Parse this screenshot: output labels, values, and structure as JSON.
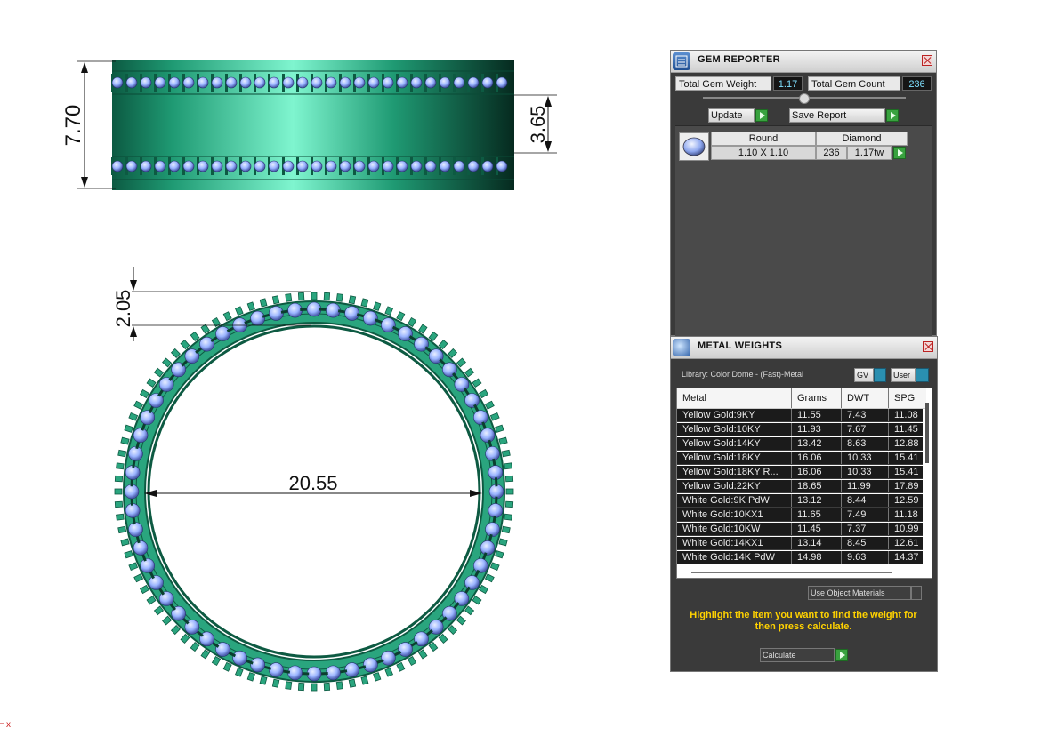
{
  "viewport": {
    "dimensions": {
      "side_height": "7.70",
      "channel_height": "3.65",
      "band_width": "2.05",
      "inner_diameter": "20.55"
    },
    "axis_marker": "x",
    "colors": {
      "metal": "#1f9a73",
      "metal_dark": "#0a4a36",
      "metal_light": "#7ff5cf",
      "gem": "#9ab4ff"
    }
  },
  "gem_reporter": {
    "title": "GEM REPORTER",
    "total_weight_label": "Total Gem Weight",
    "total_weight_value": "1.17",
    "total_count_label": "Total Gem Count",
    "total_count_value": "236",
    "update_label": "Update",
    "save_report_label": "Save Report",
    "gem": {
      "shape": "Round",
      "type": "Diamond",
      "size": "1.10 X 1.10",
      "count": "236",
      "weight": "1.17tw"
    }
  },
  "metal_weights": {
    "title": "METAL WEIGHTS",
    "library_label": "Library: Color Dome - (Fast)-Metal",
    "gv_label": "GV",
    "user_label": "User",
    "columns": [
      "Metal",
      "Grams",
      "DWT",
      "SPG"
    ],
    "rows": [
      {
        "metal": "Yellow Gold:9KY",
        "grams": "11.55",
        "dwt": "7.43",
        "spg": "11.08"
      },
      {
        "metal": "Yellow Gold:10KY",
        "grams": "11.93",
        "dwt": "7.67",
        "spg": "11.45"
      },
      {
        "metal": "Yellow Gold:14KY",
        "grams": "13.42",
        "dwt": "8.63",
        "spg": "12.88"
      },
      {
        "metal": "Yellow Gold:18KY",
        "grams": "16.06",
        "dwt": "10.33",
        "spg": "15.41"
      },
      {
        "metal": "Yellow Gold:18KY R...",
        "grams": "16.06",
        "dwt": "10.33",
        "spg": "15.41"
      },
      {
        "metal": "Yellow Gold:22KY",
        "grams": "18.65",
        "dwt": "11.99",
        "spg": "17.89"
      },
      {
        "metal": "White Gold:9K PdW",
        "grams": "13.12",
        "dwt": "8.44",
        "spg": "12.59"
      },
      {
        "metal": "White Gold:10KX1",
        "grams": "11.65",
        "dwt": "7.49",
        "spg": "11.18"
      },
      {
        "metal": "White Gold:10KW",
        "grams": "11.45",
        "dwt": "7.37",
        "spg": "10.99"
      },
      {
        "metal": "White Gold:14KX1",
        "grams": "13.14",
        "dwt": "8.45",
        "spg": "12.61"
      },
      {
        "metal": "White Gold:14K PdW",
        "grams": "14.98",
        "dwt": "9.63",
        "spg": "14.37"
      }
    ],
    "use_object_materials_label": "Use Object Materials",
    "hint": "Highlight the item you want to find the weight for then press calculate.",
    "calculate_label": "Calculate"
  }
}
